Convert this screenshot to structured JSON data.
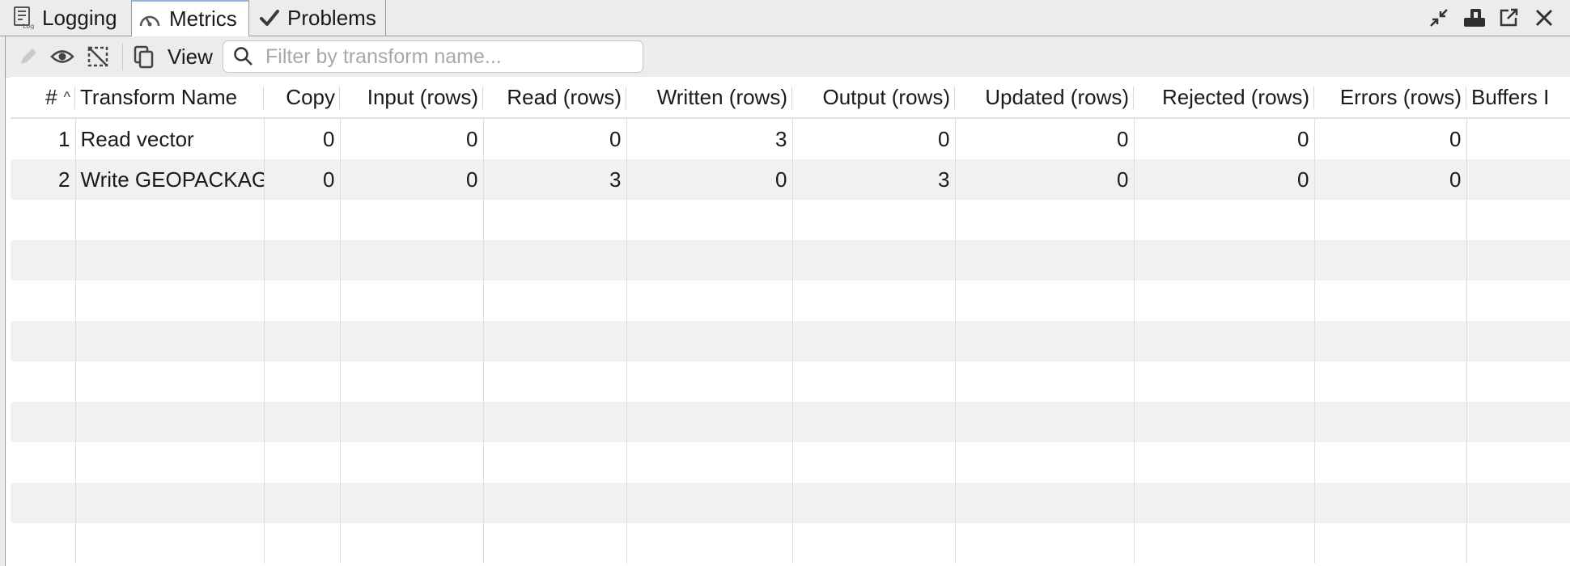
{
  "tabs": [
    {
      "label": "Logging",
      "icon": "logging-icon"
    },
    {
      "label": "Metrics",
      "icon": "gauge-icon",
      "active": true
    },
    {
      "label": "Problems",
      "icon": "checkmark-icon"
    }
  ],
  "window_controls": [
    "minimize-icon",
    "maximize-icon",
    "open-external-icon",
    "close-icon"
  ],
  "toolbar": {
    "view_label": "View",
    "search_placeholder": "Filter by transform name...",
    "search_value": ""
  },
  "table": {
    "columns": [
      "#",
      "Transform Name",
      "Copy",
      "Input (rows)",
      "Read (rows)",
      "Written (rows)",
      "Output (rows)",
      "Updated (rows)",
      "Rejected (rows)",
      "Errors (rows)",
      "Buffers I"
    ],
    "rows": [
      [
        "1",
        "Read vector",
        "0",
        "0",
        "0",
        "3",
        "0",
        "0",
        "0",
        "0",
        ""
      ],
      [
        "2",
        "Write GEOPACKAG",
        "0",
        "0",
        "3",
        "0",
        "3",
        "0",
        "0",
        "0",
        ""
      ]
    ],
    "empty_rows": 9
  },
  "colors": {
    "active_tab_accent": "#8fb5dd",
    "row_stripe": "#f0f1f1"
  }
}
